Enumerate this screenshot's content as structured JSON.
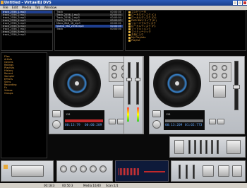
{
  "window": {
    "title": "Untitled - VirtualDJ DVS"
  },
  "menu": [
    "File",
    "Edit",
    "Media",
    "Tab",
    "Window"
  ],
  "left_list": {
    "rows": [
      "track_2556_1.mp3",
      "track_2556_2.mp3",
      "track_2556_3.mp3",
      "track_2556_4.mp3",
      "track_2556_5.mp3",
      "track_2556_6.mp3",
      "track_2556_7.mp3",
      "track_2556_8.mp3",
      "track_2556_9.mp3"
    ]
  },
  "middle_list": {
    "rows": [
      {
        "name": "Track",
        "time": "00:00:00"
      },
      {
        "name": "Track_2556_1.mp3",
        "time": "00:00:04"
      },
      {
        "name": "Track_2556_2.mp3",
        "time": "00:00:04"
      },
      {
        "name": "Track_2556_3.mp3",
        "time": "00:00:03"
      },
      {
        "name": "Mono_8bit_16_mp3",
        "time": "00:00:01"
      },
      {
        "name": "Nuevo_Mix_2556.mp3",
        "time": "00:00:05"
      },
      {
        "name": "Track",
        "time": "00:00:00"
      }
    ]
  },
  "right_tree": {
    "items": [
      "コンピュータ",
      "ローカルディスク (C:)",
      "ローカルディスク (D:)",
      "DVD RWドライブ (E:)",
      "リムーバブルディスク",
      "ローカルディスク (F:)",
      "マイドキュメント",
      "マイミュージック",
      "お気に入り",
      "My Playlists",
      "Playlist"
    ]
  },
  "side_nav": {
    "items": [
      "Files",
      "Artists",
      "Genres",
      "Ratings",
      "Playlists",
      "History",
      "Recent",
      "Sampler",
      "Effects",
      "Skins",
      "Recording",
      "Fx",
      "Videos",
      "Groups"
    ]
  },
  "deck_left": {
    "bpm": "128",
    "time": "00:13:79",
    "remaining": "00:00:209",
    "pitch": "0.0%"
  },
  "deck_right": {
    "bpm": "128",
    "time": "00:13:209",
    "remaining": "01:02:773",
    "pitch": "0.0%"
  },
  "status": {
    "a": "00:18:3",
    "b": "00:50:3",
    "c": "Media:10/40",
    "d": "Scan:1/1"
  },
  "colors": {
    "accent": "#3a8ad8",
    "selection": "#1f3f8f",
    "waveform": "#c0282a"
  }
}
